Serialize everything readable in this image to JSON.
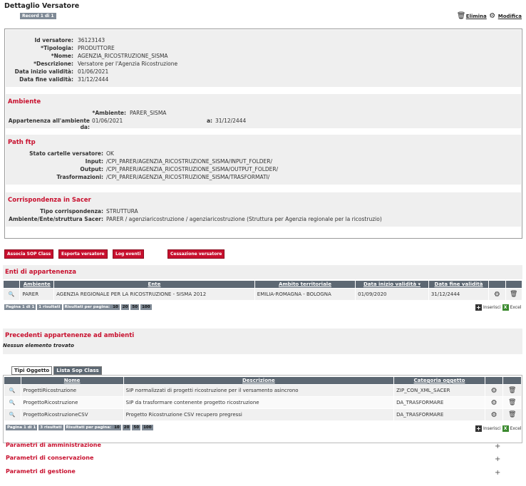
{
  "page": {
    "title": "Dettaglio Versatore",
    "record": "Record 1 di 1",
    "elimina": "Elimina",
    "modifica": "Modifica"
  },
  "detail": {
    "fields": [
      {
        "label": "Id versatore:",
        "value": "36123143"
      },
      {
        "label": "*Tipologia:",
        "value": "PRODUTTORE"
      },
      {
        "label": "*Nome:",
        "value": "AGENZIA_RICOSTRUZIONE_SISMA"
      },
      {
        "label": "*Descrizione:",
        "value": "Versatore per l'Agenzia Ricostruzione"
      },
      {
        "label": "Data inizio validità:",
        "value": "01/06/2021"
      },
      {
        "label": "Data fine validità:",
        "value": "31/12/2444"
      }
    ]
  },
  "ambiente": {
    "title": "Ambiente",
    "ambiente_label": "*Ambiente:",
    "ambiente_value": "PARER_SISMA",
    "appartenenza_label": "Appartenenza all'ambiente da:",
    "appartenenza_da": "01/06/2021",
    "a_label": "a:",
    "appartenenza_a": "31/12/2444"
  },
  "ftp": {
    "title": "Path ftp",
    "fields": [
      {
        "label": "Stato cartelle versatore:",
        "value": "OK"
      },
      {
        "label": "Input:",
        "value": "/CPI_PARER/AGENZIA_RICOSTRUZIONE_SISMA/INPUT_FOLDER/"
      },
      {
        "label": "Output:",
        "value": "/CPI_PARER/AGENZIA_RICOSTRUZIONE_SISMA/OUTPUT_FOLDER/"
      },
      {
        "label": "Trasformazioni:",
        "value": "/CPI_PARER/AGENZIA_RICOSTRUZIONE_SISMA/TRASFORMATI/"
      }
    ]
  },
  "sacer": {
    "title": "Corrispondenza in Sacer",
    "fields": [
      {
        "label": "Tipo corrispondenza:",
        "value": "STRUTTURA"
      },
      {
        "label": "Ambiente/Ente/struttura Sacer:",
        "value": "PARER / agenziaricostruzione / agenziaricostruzione (Struttura per Agenzia regionale per la ricostruzio)"
      }
    ]
  },
  "actions": {
    "associa": "Associa SOP Class",
    "esporta": "Esporta versatore",
    "log": "Log eventi",
    "cessazione": "Cessazione versatore"
  },
  "enti": {
    "title": "Enti di appartenenza",
    "headers": [
      "Ambiente",
      "Ente",
      "Ambito territoriale",
      "Data inizio validità ▾",
      "Data fine validità"
    ],
    "rows": [
      {
        "ambiente": "PARER",
        "ente": "AGENZIA REGIONALE PER LA RICOSTRUZIONE - SISMA 2012",
        "ambito": "EMILIA-ROMAGNA - BOLOGNA",
        "inizio": "01/09/2020",
        "fine": "31/12/2444"
      }
    ],
    "pager": {
      "page": "Pagina 1 di 1",
      "results": "1 risultati",
      "per_page": "Risultati per pagina:",
      "opts": [
        "10",
        "20",
        "50",
        "100"
      ]
    },
    "inserisci": "Inserisci",
    "excel": "Excel"
  },
  "precedenti": {
    "title": "Precedenti appartenenze ad ambienti",
    "empty": "Nessun elemento trovato"
  },
  "tabs": [
    "Tipi Oggetto",
    "Lista Sop Class"
  ],
  "oggetti": {
    "headers": [
      "Nome",
      "Descrizione",
      "Categoria oggetto"
    ],
    "rows": [
      {
        "nome": "ProgettiRicostruzione",
        "descrizione": "SIP normalizzati di progetti ricostruzione per il versamento asincrono",
        "categoria": "ZIP_CON_XML_SACER"
      },
      {
        "nome": "ProgettoRicostruzione",
        "descrizione": "SIP da trasformare contenente progetto ricostruzione",
        "categoria": "DA_TRASFORMARE"
      },
      {
        "nome": "ProgettoRicostruzioneCSV",
        "descrizione": "Progetto Ricostruzione CSV recupero pregressi",
        "categoria": "DA_TRASFORMARE"
      }
    ],
    "pager": {
      "page": "Pagina 1 di 1",
      "results": "3 risultati",
      "per_page": "Risultati per pagina:",
      "opts": [
        "10",
        "20",
        "50",
        "100"
      ]
    },
    "inserisci": "Inserisci",
    "excel": "Excel"
  },
  "collapsibles": [
    "Parametri di amministrazione",
    "Parametri di conservazione",
    "Parametri di gestione"
  ]
}
